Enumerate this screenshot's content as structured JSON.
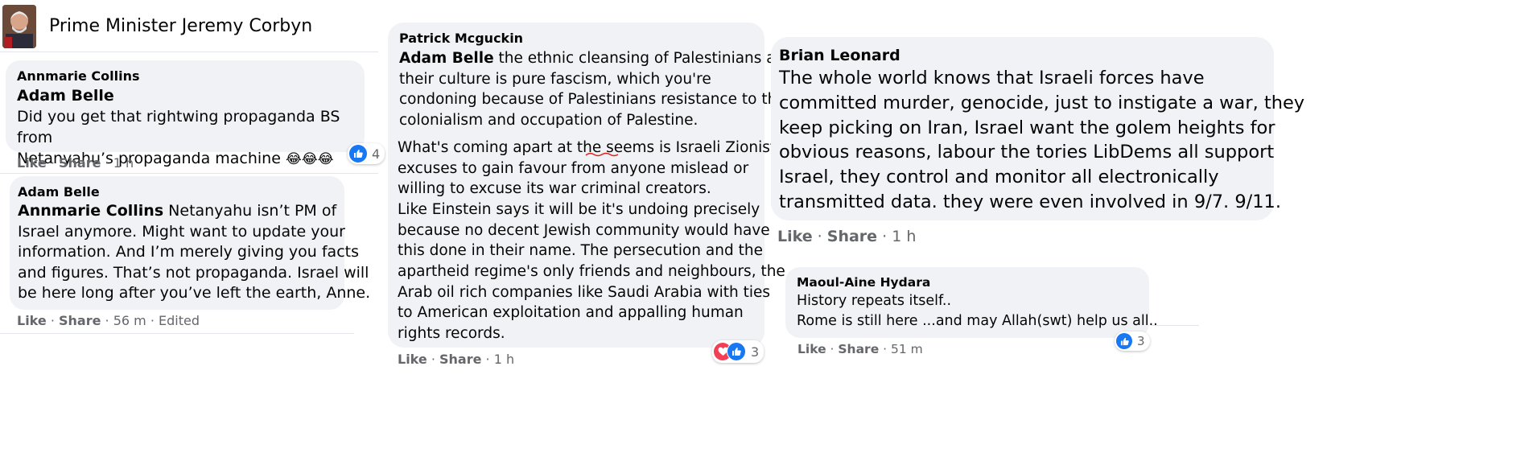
{
  "post": {
    "page_name": "Prime Minister Jeremy Corbyn"
  },
  "col1": {
    "c1": {
      "author": "Annmarie Collins",
      "mention": "Adam Belle",
      "line1": "Did you get that rightwing propaganda BS from",
      "line2": "Netanyahu’s propaganda machine",
      "emoji": "😂😂😂",
      "like": "Like",
      "share": "Share",
      "time": "1 h",
      "reaction_count": "4"
    },
    "c2": {
      "author": "Adam Belle",
      "mention": "Annmarie Collins",
      "lines": [
        " Netanyahu isn’t PM of",
        "Israel anymore. Might want to update your",
        "information. And I’m merely giving you facts",
        "and figures. That’s not propaganda. Israel will",
        "be here long after you’ve left the earth, Anne."
      ],
      "like": "Like",
      "share": "Share",
      "time": "56 m",
      "edited": "Edited"
    }
  },
  "col2": {
    "author": "Patrick Mcguckin",
    "mention": "Adam Belle",
    "para1": [
      " the ethnic cleansing of Palestinians and",
      "their culture is pure fascism, which you're",
      "condoning because of Palestinians resistance to the",
      "colonialism and occupation of Palestine."
    ],
    "para2": [
      "What's coming apart at the seems is Israeli Zionist",
      "excuses to gain favour from anyone mislead or",
      "willing to excuse its war criminal creators.",
      "Like Einstein says it will be it's undoing precisely",
      "because no decent Jewish community would have",
      "this done in their name. The persecution and the",
      "apartheid regime's only friends and neighbours, the",
      "Arab oil rich companies like Saudi Arabia with ties",
      "to American exploitation and appalling human",
      "rights records."
    ],
    "like": "Like",
    "share": "Share",
    "time": "1 h",
    "reaction_count": "3"
  },
  "col3": {
    "c1": {
      "author": "Brian Leonard",
      "lines": [
        "The whole world knows that Israeli forces have",
        "committed murder, genocide, just to instigate a war, they",
        "keep picking on Iran, Israel want the golem heights for",
        "obvious reasons, labour the tories LibDems all support",
        "Israel, they control and monitor all electronically",
        "transmitted data. they were even involved in 9/7. 9/11."
      ],
      "like": "Like",
      "share": "Share",
      "time": "1 h"
    },
    "c2": {
      "author": "Maoul-Aine Hydara",
      "line1": "History repeats itself..",
      "line2": "Rome is still here ...and may Allah(swt) help us all..",
      "like": "Like",
      "share": "Share",
      "time": "51 m",
      "reaction_count": "3"
    }
  },
  "icons": {
    "avatar": "profile-photo",
    "like_reaction": "thumbs-up-icon",
    "love_reaction": "heart-icon"
  },
  "colors": {
    "bubble": "#f0f2f5",
    "meta_text": "#65676b",
    "like_blue": "#1877f2",
    "love_red": "#f33e58"
  }
}
